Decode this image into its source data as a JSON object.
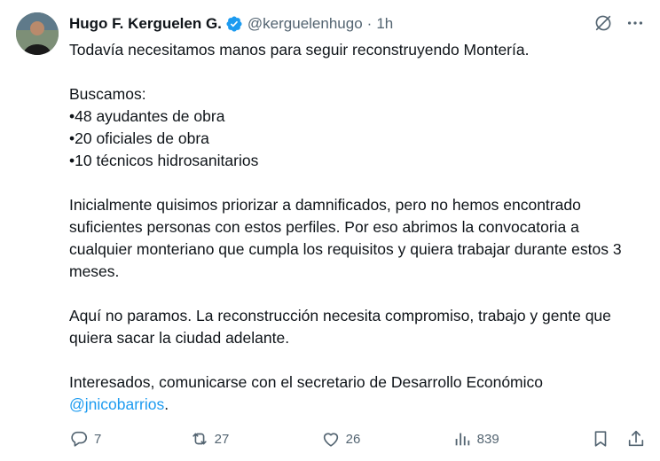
{
  "tweet": {
    "author": {
      "display_name": "Hugo F. Kerguelen G.",
      "handle": "@kerguelenhugo",
      "separator": "·",
      "time": "1h"
    },
    "intro": "Todavía necesitamos manos para seguir reconstruyendo Montería.",
    "buscamos_label": "Buscamos:",
    "positions": [
      "•48 ayudantes de obra",
      "•20 oficiales de obra",
      "•10 técnicos hidrosanitarios"
    ],
    "paragraph_2": "Inicialmente quisimos priorizar a damnificados, pero no hemos encontrado suficientes personas con estos perfiles. Por eso abrimos la convocatoria a cualquier monteriano que cumpla los requisitos y quiera trabajar durante estos 3 meses.",
    "paragraph_3": "Aquí no paramos. La reconstrucción necesita compromiso, trabajo y gente que quiera sacar la ciudad adelante.",
    "paragraph_4_prefix": "Interesados, comunicarse con el secretario de Desarrollo Económico",
    "mention": "@jnicobarrios",
    "paragraph_4_suffix": "."
  },
  "actions": {
    "replies": "7",
    "reposts": "27",
    "likes": "26",
    "views": "839"
  },
  "icons": {
    "verified": "verified-badge-icon",
    "grok": "grok-icon",
    "more": "more-icon",
    "reply": "reply-icon",
    "repost": "repost-icon",
    "like": "like-icon",
    "views": "views-icon",
    "bookmark": "bookmark-icon",
    "share": "share-icon"
  },
  "colors": {
    "text": "#0f1419",
    "secondary": "#536471",
    "link": "#1d9bf0",
    "verified": "#1d9bf0"
  }
}
